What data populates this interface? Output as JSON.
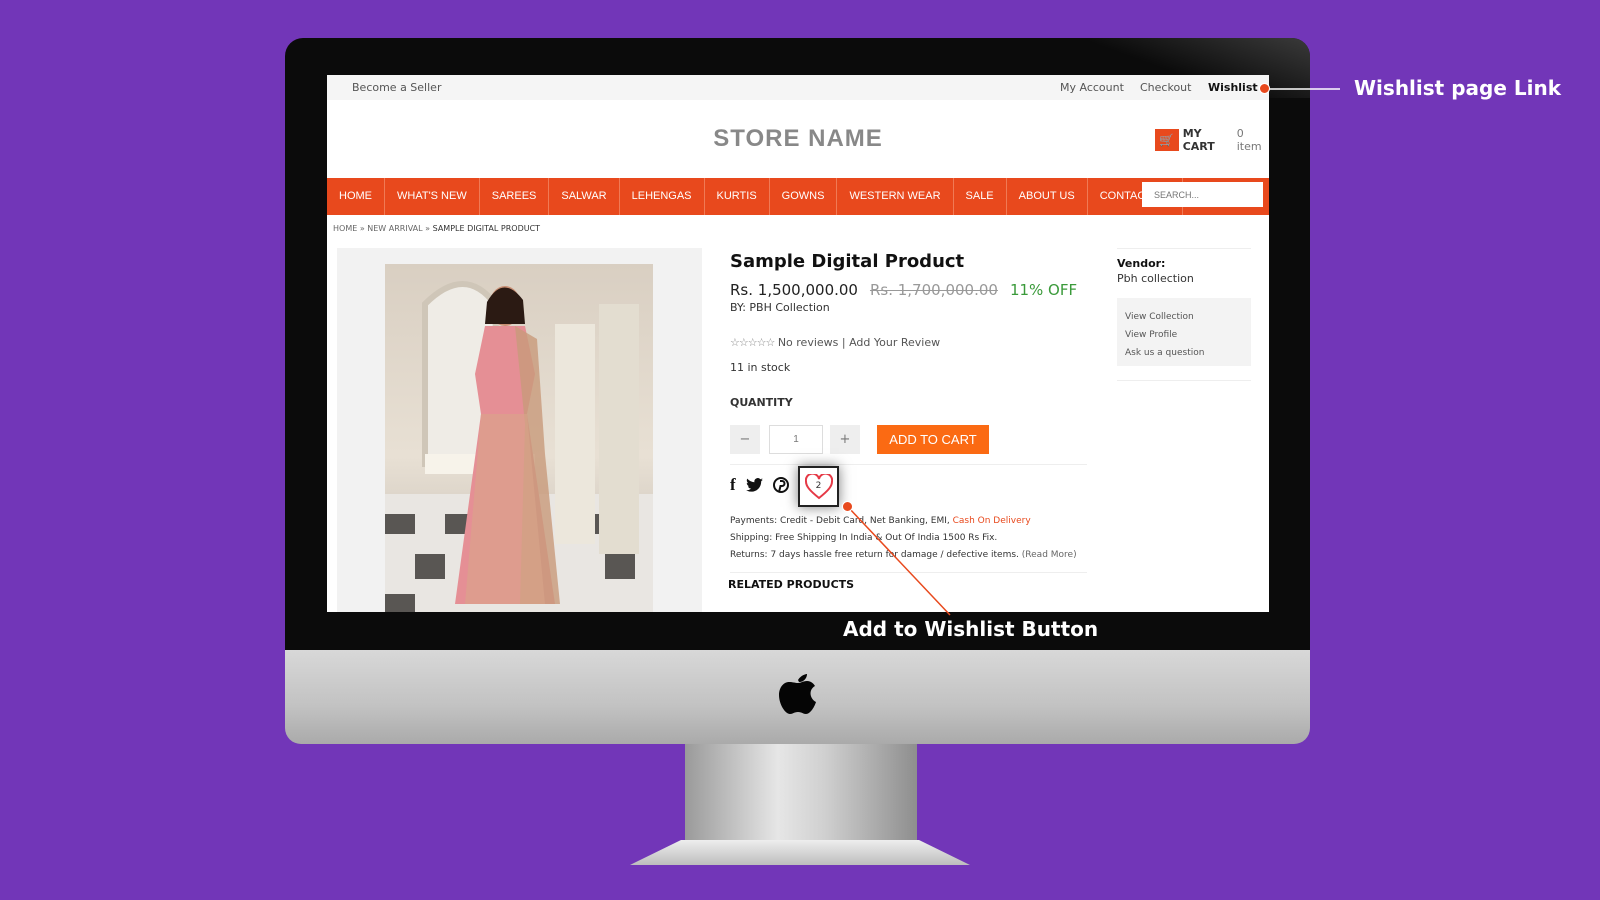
{
  "topbar": {
    "seller": "Become a Seller",
    "account": "My Account",
    "checkout": "Checkout",
    "wishlist": "Wishlist"
  },
  "header": {
    "store_name": "STORE NAME",
    "cart_label": "MY CART",
    "cart_count": "0 item"
  },
  "nav": {
    "items": [
      "HOME",
      "WHAT'S NEW",
      "SAREES",
      "SALWAR",
      "LEHENGAS",
      "KURTIS",
      "GOWNS",
      "WESTERN WEAR",
      "SALE",
      "ABOUT US",
      "CONTACT US"
    ],
    "search_placeholder": "SEARCH..."
  },
  "breadcrumb": [
    "HOME",
    "NEW ARRIVAL",
    "SAMPLE DIGITAL PRODUCT"
  ],
  "product": {
    "title": "Sample Digital Product",
    "price": "Rs. 1,500,000.00",
    "old_price": "Rs. 1,700,000.00",
    "discount": "11% OFF",
    "by": "BY: PBH Collection",
    "reviews": "No reviews |",
    "add_review": "Add Your Review",
    "rating": 0,
    "rating_max": 5,
    "stock": "11 in stock",
    "quantity_label": "QUANTITY",
    "quantity": "1",
    "minus": "−",
    "plus": "+",
    "add_to_cart": "ADD TO CART",
    "wishlist_count": "2",
    "payments": "Payments: Credit - Debit Card, Net Banking, EMI, ",
    "cod": "Cash On Delivery",
    "shipping": "Shipping: Free Shipping In India & Out Of India 1500 Rs Fix.",
    "returns": "Returns: 7 days hassle free return for damage / defective items. ",
    "read_more": "(Read More)",
    "related": "RELATED PRODUCTS"
  },
  "vendor": {
    "label": "Vendor:",
    "name": "Pbh collection",
    "links": [
      "View Collection",
      "View Profile",
      "Ask us a question"
    ]
  },
  "annotations": {
    "wishlist_link": "Wishlist page Link",
    "wishlist_button": "Add to Wishlist Button"
  },
  "colors": {
    "accent": "#e8491d",
    "button": "#fb6a13",
    "background": "#7236b8",
    "discount": "#3a9a3a"
  }
}
